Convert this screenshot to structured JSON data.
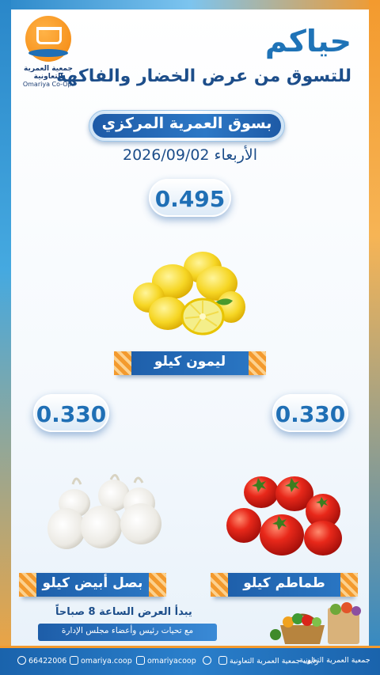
{
  "header": {
    "greeting": "حياكم",
    "subtitle": "للتسوق من عرض الخضار والفاكهة",
    "market": "بسوق العمرية المركزي",
    "date": "الأربعاء 2026/09/02"
  },
  "logo": {
    "name_ar": "جمعية العمرية التعاونية",
    "name_en": "Omariya Co-Op."
  },
  "products": [
    {
      "name": "ليمون كيلو",
      "price": "0.495",
      "icon": "lemon"
    },
    {
      "name": "طماطم كيلو",
      "price": "0.330",
      "icon": "tomato"
    },
    {
      "name": "بصل أبيض كيلو",
      "price": "0.330",
      "icon": "onion"
    }
  ],
  "footer_info": {
    "start_time": "يبدأ العرض الساعة 8 صباحاً",
    "regards": "مع تحيات رئيس وأعضاء مجلس الإدارة"
  },
  "footer": {
    "phone": "66422006",
    "instagram": "omariya.coop",
    "x": "omariyacoop",
    "youtube": "زايف جمعية العمرية التعاونية",
    "snapchat": "جمعية العمرية التعاونية"
  },
  "colors": {
    "primary": "#1f6fb5",
    "accent": "#f39a2e"
  }
}
